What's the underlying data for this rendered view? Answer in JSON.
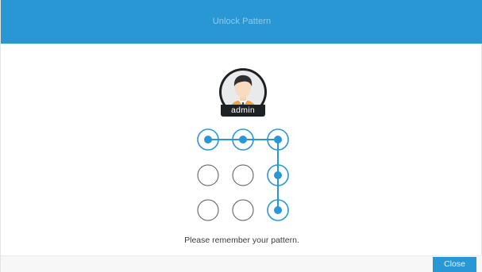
{
  "dialog": {
    "title": "Unlock Pattern"
  },
  "user": {
    "name": "admin",
    "avatar_icon": "user-avatar-icon"
  },
  "pattern": {
    "accent_color": "#2a97d5",
    "inactive_color": "#555555",
    "grid_size": 3,
    "selected_nodes": [
      0,
      1,
      2,
      5,
      8
    ],
    "path_sequence": [
      0,
      1,
      2,
      5,
      8
    ]
  },
  "hint": "Please remember your pattern.",
  "footer": {
    "close_label": "Close"
  },
  "colors": {
    "header": "#2a97d5",
    "button": "#2a97d5"
  }
}
